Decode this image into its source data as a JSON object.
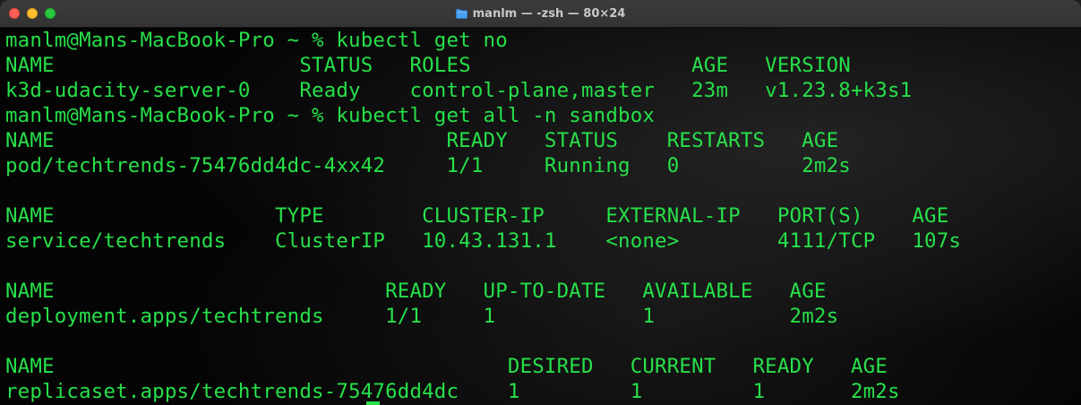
{
  "window": {
    "title": "manlm — -zsh — 80×24"
  },
  "terminal": {
    "lines": [
      "manlm@Mans-MacBook-Pro ~ % kubectl get no",
      "NAME                    STATUS   ROLES                  AGE   VERSION",
      "k3d-udacity-server-0    Ready    control-plane,master   23m   v1.23.8+k3s1",
      "manlm@Mans-MacBook-Pro ~ % kubectl get all -n sandbox",
      "NAME                                READY   STATUS    RESTARTS   AGE",
      "pod/techtrends-75476dd4dc-4xx42     1/1     Running   0          2m2s",
      "",
      "NAME                  TYPE        CLUSTER-IP     EXTERNAL-IP   PORT(S)    AGE",
      "service/techtrends    ClusterIP   10.43.131.1    <none>        4111/TCP   107s",
      "",
      "NAME                           READY   UP-TO-DATE   AVAILABLE   AGE",
      "deployment.apps/techtrends     1/1     1            1           2m2s",
      "",
      "NAME                                     DESIRED   CURRENT   READY   AGE",
      "replicaset.apps/techtrends-75476dd4dc    1         1         1       2m2s"
    ]
  },
  "colors": {
    "terminal_text": "#27e04a",
    "close": "#ff5f57",
    "minimize": "#febc2e",
    "zoom": "#28c840"
  },
  "icons": {
    "title": "folder-icon"
  }
}
